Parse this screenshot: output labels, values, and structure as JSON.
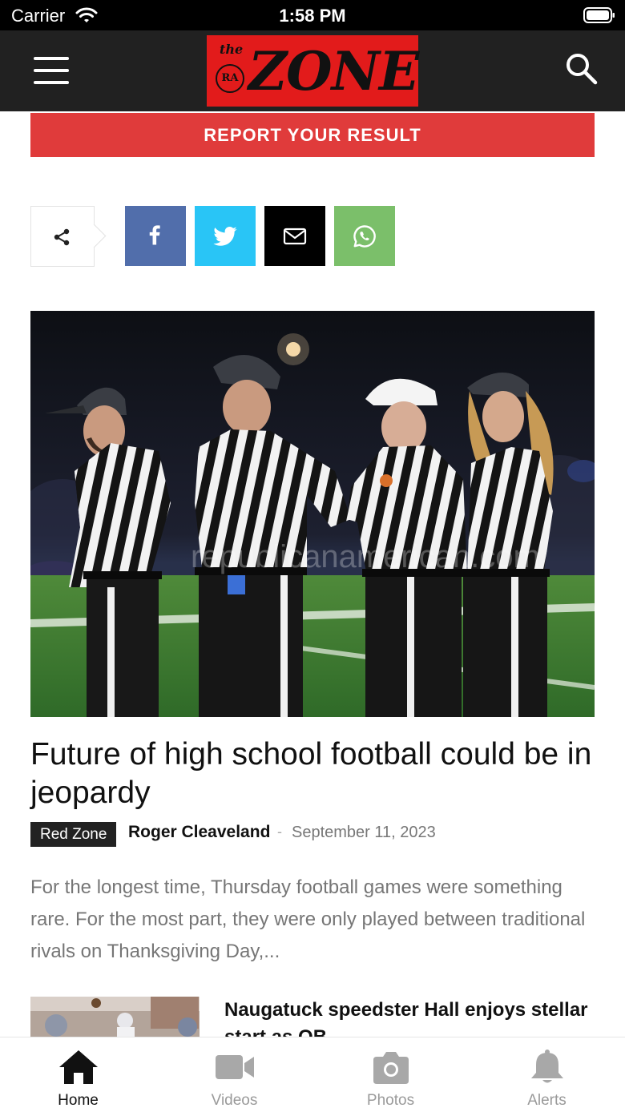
{
  "status_bar": {
    "carrier": "Carrier",
    "time": "1:58 PM"
  },
  "header": {
    "logo": {
      "small_text": "the",
      "badge_text": "RA",
      "main_text": "ZONE"
    },
    "menu_icon": "hamburger-icon",
    "search_icon": "search-icon"
  },
  "banner": {
    "label": "REPORT YOUR RESULT",
    "color": "#e03b3b"
  },
  "share": {
    "icons": [
      "share-icon",
      "facebook-icon",
      "twitter-icon",
      "email-icon",
      "whatsapp-icon"
    ],
    "colors": {
      "facebook": "#516eab",
      "twitter": "#29c5f6",
      "email": "#000000",
      "whatsapp": "#7bbf6a"
    }
  },
  "article": {
    "image_watermark": "republicanamerican.com",
    "title": "Future of high school football could be in jeopardy",
    "category": "Red Zone",
    "author": "Roger Cleaveland",
    "separator": "-",
    "date": "September 11, 2023",
    "excerpt": "For the longest time, Thursday football games were something rare. For the most part, they were only played between traditional rivals on Thanksgiving Day,..."
  },
  "next_article": {
    "title": "Naugatuck speedster Hall enjoys stellar start as QB"
  },
  "tab_bar": {
    "tabs": [
      {
        "label": "Home",
        "icon": "home-icon",
        "active": true
      },
      {
        "label": "Videos",
        "icon": "video-camera-icon",
        "active": false
      },
      {
        "label": "Photos",
        "icon": "camera-icon",
        "active": false
      },
      {
        "label": "Alerts",
        "icon": "bell-icon",
        "active": false
      }
    ]
  }
}
